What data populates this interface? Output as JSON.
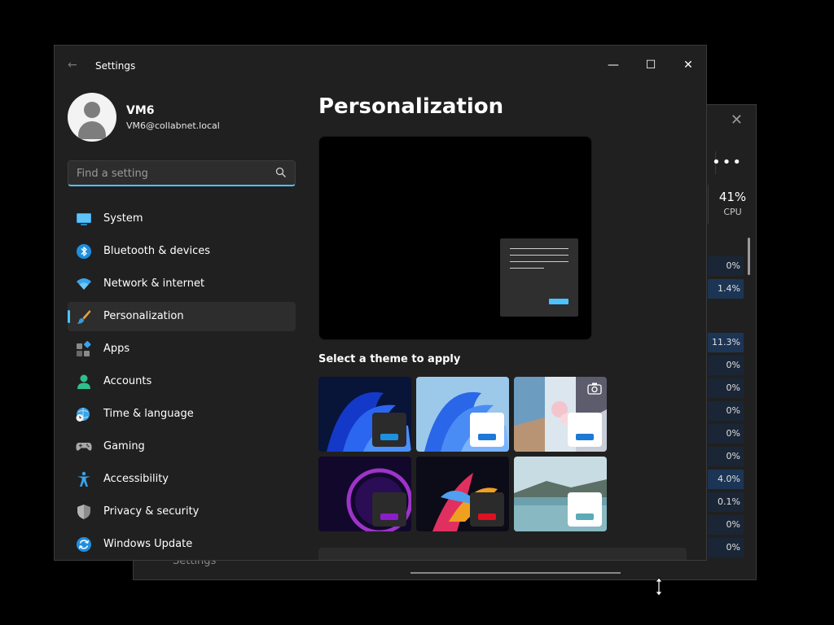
{
  "background_window": {
    "cpu_percent": "41%",
    "cpu_label": "CPU",
    "values": [
      "0%",
      "1.4%",
      "11.3%",
      "0%",
      "0%",
      "0%",
      "0%",
      "0%",
      "4.0%",
      "0.1%",
      "0%",
      "0%"
    ],
    "bottom_text": "Settings"
  },
  "window": {
    "title": "Settings"
  },
  "profile": {
    "name": "VM6",
    "email": "VM6@collabnet.local"
  },
  "search": {
    "placeholder": "Find a setting"
  },
  "nav": {
    "items": [
      {
        "label": "System",
        "icon": "system-icon"
      },
      {
        "label": "Bluetooth & devices",
        "icon": "bluetooth-icon"
      },
      {
        "label": "Network & internet",
        "icon": "wifi-icon"
      },
      {
        "label": "Personalization",
        "icon": "brush-icon",
        "active": true
      },
      {
        "label": "Apps",
        "icon": "apps-icon"
      },
      {
        "label": "Accounts",
        "icon": "accounts-icon"
      },
      {
        "label": "Time & language",
        "icon": "time-language-icon"
      },
      {
        "label": "Gaming",
        "icon": "gamepad-icon"
      },
      {
        "label": "Accessibility",
        "icon": "accessibility-icon"
      },
      {
        "label": "Privacy & security",
        "icon": "shield-icon"
      },
      {
        "label": "Windows Update",
        "icon": "update-icon"
      }
    ]
  },
  "main": {
    "title": "Personalization",
    "theme_section_label": "Select a theme to apply",
    "themes": [
      {
        "name": "windows-dark",
        "accent": "#1e90e0"
      },
      {
        "name": "windows-light",
        "accent": "#1e78d6"
      },
      {
        "name": "captured-motion",
        "accent": "#1e78d6"
      },
      {
        "name": "glow",
        "accent": "#8a1ec8"
      },
      {
        "name": "sunrise",
        "accent": "#e01020"
      },
      {
        "name": "flow",
        "accent": "#5aaab8"
      }
    ]
  },
  "colors": {
    "accent": "#4cc2ff",
    "window_bg": "#202020",
    "nav_active": "#2d2d2d"
  }
}
